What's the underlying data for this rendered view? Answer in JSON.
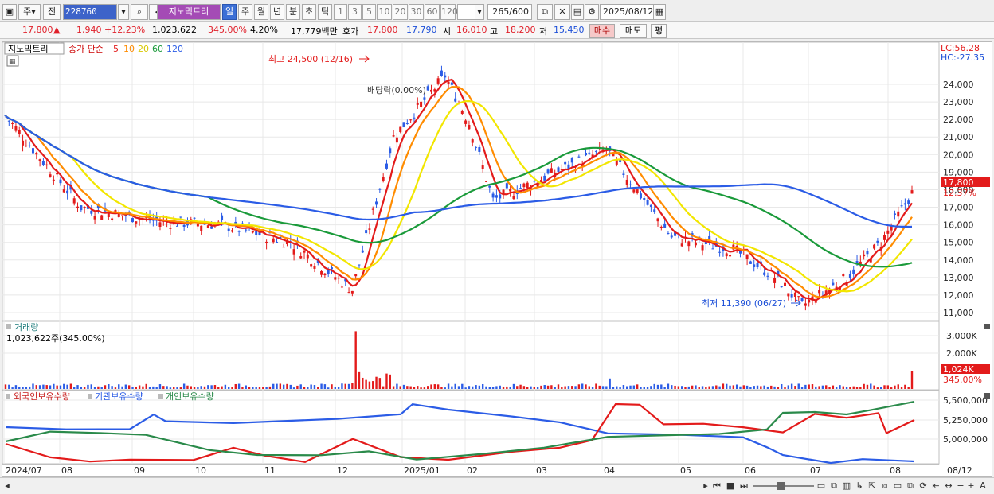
{
  "toolbar": {
    "type1": "주",
    "type2": "전",
    "code": "228760",
    "name": "지노믹트리",
    "periods": [
      "일",
      "주",
      "월",
      "년",
      "분",
      "초",
      "틱"
    ],
    "selected_period": "일",
    "minutes": [
      "1",
      "3",
      "5",
      "10",
      "20",
      "30",
      "60",
      "120"
    ],
    "count": "265/600",
    "date": "2025/08/12"
  },
  "quote": {
    "price": "17,800",
    "price_mark": "▲",
    "change": "1,940",
    "change_pct": "+12.23%",
    "volume": "1,023,622",
    "volume_pct": "345.00%",
    "turnover": "4.20%",
    "amount": "17,779백만",
    "ask_label": "호가",
    "ask": "17,800",
    "bid": "17,790",
    "open_label": "시",
    "open": "16,010",
    "high_label": "고",
    "high": "18,200",
    "low_label": "저",
    "low": "15,450",
    "buy": "매수",
    "sell": "매도",
    "eval": "평"
  },
  "price_panel": {
    "title": "지노믹트리",
    "ma_label": "종가 단순",
    "ma_periods": [
      "5",
      "10",
      "20",
      "60",
      "120"
    ],
    "ma_colors": [
      "#e31b1b",
      "#ff8c00",
      "#f2e600",
      "#1a9a3a",
      "#2b5ce6"
    ],
    "lc": "LC:56.28",
    "hc": "HC:-27.35",
    "high_note": "최고 24,500 (12/16)",
    "low_note": "최저 11,390 (06/27)",
    "ref_note": "배당락(0.00%)",
    "current_price": "17,800",
    "current_pct": "12.37%",
    "y_ticks": [
      "24,000",
      "23,000",
      "22,000",
      "21,000",
      "20,000",
      "19,000",
      "18,000",
      "17,000",
      "16,000",
      "15,000",
      "14,000",
      "13,000",
      "12,000",
      "11,000"
    ]
  },
  "volume_panel": {
    "title": "거래량",
    "info": "1,023,622주(345.00%)",
    "y_ticks": [
      "3,000K",
      "2,000K"
    ],
    "current": "1,024K",
    "current_pct": "345.00%"
  },
  "holding_panel": {
    "legend": [
      "외국인보유수량",
      "기관보유수량",
      "개인보유수량"
    ],
    "y_ticks": [
      "5,500,000",
      "5,250,000",
      "5,000,000"
    ]
  },
  "x_axis": [
    "2024/07",
    "08",
    "09",
    "10",
    "11",
    "12",
    "2025/01",
    "02",
    "03",
    "04",
    "05",
    "06",
    "07",
    "08",
    "08/12"
  ],
  "chart_data": {
    "type": "candlestick",
    "title": "지노믹트리",
    "x_range": [
      "2024/07",
      "2025/08/12"
    ],
    "ylim": [
      11000,
      24500
    ],
    "approx_close_path": [
      {
        "x": "2024/07",
        "y": 22200
      },
      {
        "x": "08",
        "y": 17000
      },
      {
        "x": "09",
        "y": 16200
      },
      {
        "x": "10",
        "y": 16000
      },
      {
        "x": "11",
        "y": 15000
      },
      {
        "x": "11-late",
        "y": 12300
      },
      {
        "x": "12",
        "y": 21000
      },
      {
        "x": "12/16",
        "y": 24500
      },
      {
        "x": "2025/01",
        "y": 21800
      },
      {
        "x": "02",
        "y": 17400
      },
      {
        "x": "03",
        "y": 20300
      },
      {
        "x": "04",
        "y": 15300
      },
      {
        "x": "05",
        "y": 14600
      },
      {
        "x": "06",
        "y": 12900
      },
      {
        "x": "06/27",
        "y": 11390
      },
      {
        "x": "07",
        "y": 13000
      },
      {
        "x": "08",
        "y": 15000
      },
      {
        "x": "08/12",
        "y": 17800
      }
    ]
  }
}
